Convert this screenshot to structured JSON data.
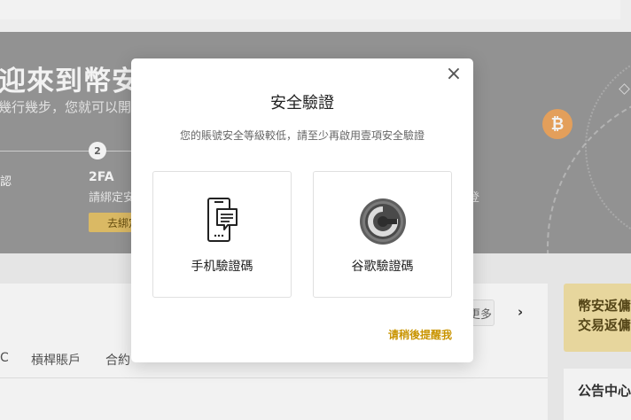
{
  "background": {
    "banner": {
      "title": "迎來到幣安！",
      "subtitle": "幾行幾步，您就可以開",
      "step_left_mark": "認",
      "step2_number": "2",
      "step2_title": "2FA",
      "step2_desc": "請綁定安",
      "step2_button": "去綁定",
      "right_step_desc": "登"
    },
    "content": {
      "more_button": "更多",
      "tabs": [
        "C",
        "槓桿賬戶",
        "合約"
      ]
    },
    "promo_card": {
      "line1": "幣安返傭",
      "line2": "交易返傭"
    },
    "notice_card": {
      "title": "公告中心"
    },
    "icons": [
      "bitcoin-icon",
      "diamond-icon",
      "chevron-right-icon"
    ]
  },
  "modal": {
    "title": "安全驗證",
    "description": "您的賬號安全等級較低，請至少再啟用壹項安全驗證",
    "close_icon": "×",
    "options": [
      {
        "icon": "phone-sms-icon",
        "label": "手机驗證碼"
      },
      {
        "icon": "google-authenticator-icon",
        "label": "谷歌驗證碼"
      }
    ],
    "remind_later": "请稍後提醒我"
  },
  "colors": {
    "accent": "#c99400",
    "banner_bg": "#9a9a9a",
    "bitcoin": "#f0a860",
    "promo_bg": "#f4e2a6"
  }
}
